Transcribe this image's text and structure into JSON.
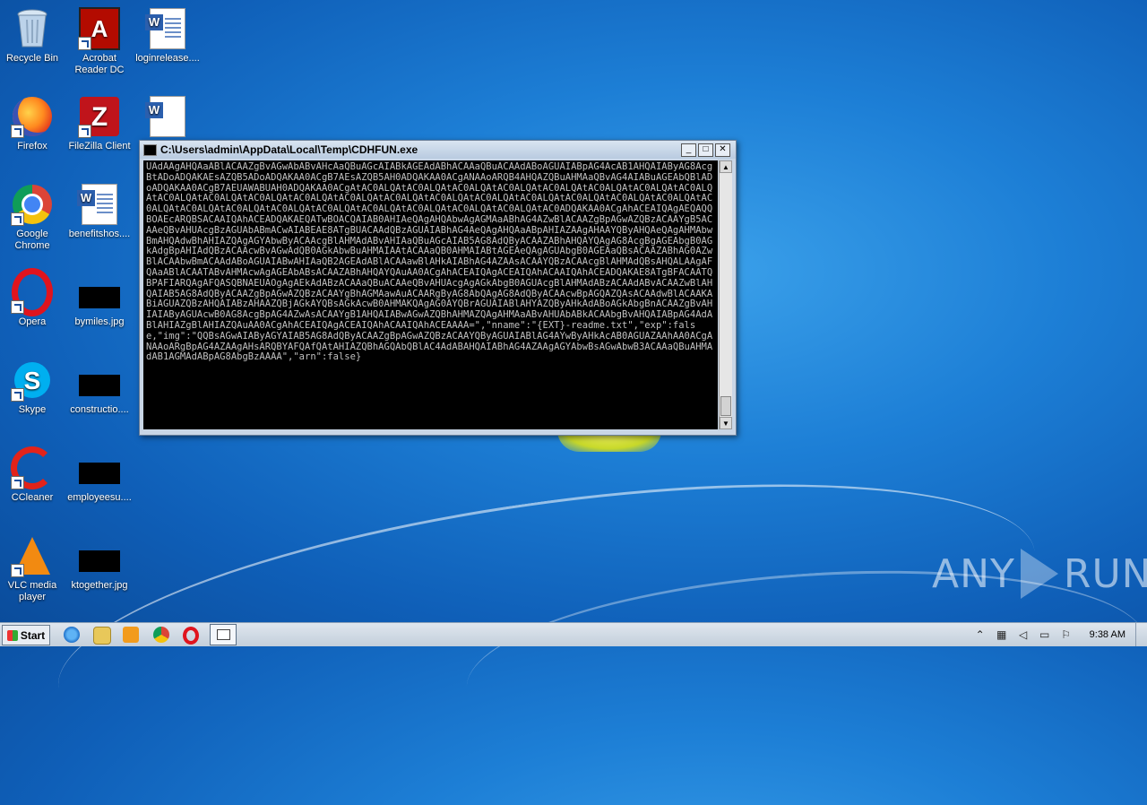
{
  "desktop": {
    "icons": [
      {
        "label": "Recycle Bin",
        "icon": "recycle-bin-icon"
      },
      {
        "label": "Acrobat Reader DC",
        "icon": "acrobat-icon"
      },
      {
        "label": "loginrelease....",
        "icon": "word-doc-icon"
      },
      {
        "label": "Firefox",
        "icon": "firefox-icon"
      },
      {
        "label": "FileZilla Client",
        "icon": "filezilla-icon"
      },
      {
        "label": "",
        "icon": "word-doc-icon"
      },
      {
        "label": "Google Chrome",
        "icon": "chrome-icon"
      },
      {
        "label": "benefitshos....",
        "icon": "word-doc-icon"
      },
      {
        "label": "Opera",
        "icon": "opera-icon"
      },
      {
        "label": "bymiles.jpg",
        "icon": "image-thumb-icon"
      },
      {
        "label": "Skype",
        "icon": "skype-icon"
      },
      {
        "label": "constructio....",
        "icon": "image-thumb-icon"
      },
      {
        "label": "CCleaner",
        "icon": "ccleaner-icon"
      },
      {
        "label": "employeesu....",
        "icon": "image-thumb-icon"
      },
      {
        "label": "VLC media player",
        "icon": "vlc-icon"
      },
      {
        "label": "ktogether.jpg",
        "icon": "image-thumb-icon"
      }
    ]
  },
  "console": {
    "title": "C:\\Users\\admin\\AppData\\Local\\Temp\\CDHFUN.exe",
    "minimize": "_",
    "maximize": "□",
    "close": "✕",
    "output": "UAdAAgAHQAaABlACAAZgBvAGwAbABvAHcAaQBuAGcAIABkAGEAdABhACAAaQBuACAAdABoAGUAIABpAG4AcAB1AHQAIAByAG8AcgBtADoADQAKAEsAZQB5ADoADQAKAA0ACgB7AEsAZQB5AH0ADQAKAA0ACgANAAoARQB4AHQAZQBuAHMAaQBvAG4AIABuAGEAbQBlADoADQAKAA0ACgB7AEUAWABUAH0ADQAKAA0ACgAtAC0ALQAtAC0ALQAtAC0ALQAtAC0ALQAtAC0ALQAtAC0ALQAtAC0ALQAtAC0ALQAtAC0ALQAtAC0ALQAtAC0ALQAtAC0ALQAtAC0ALQAtAC0ALQAtAC0ALQAtAC0ALQAtAC0ALQAtAC0ALQAtAC0ALQAtAC0ALQAtAC0ALQAtAC0ALQAtAC0ALQAtAC0ALQAtAC0ALQAtAC0ALQAtAC0ALQAtAC0ALQAtAC0ALQAtAC0ADQAKAA0ACgAhACEAIQAgAEQAQQBOAEcARQBSACAAIQAhACEADQAKAEQATwBOACQAIAB0AHIAeQAgAHQAbwAgAGMAaABhAG4AZwBlACAAZgBpAGwAZQBzACAAYgB5ACAAeQBvAHUAcgBzAGUAbABmACwAIABEAE8ATgBUACAAdQBzAGUAIABhAG4AeQAgAHQAaABpAHIAZAAgAHAAYQByAHQAeQAgAHMAbwBmAHQAdwBhAHIAZQAgAGYAbwByACAAcgBlAHMAdABvAHIAaQBuAGcAIAB5AG8AdQByACAAZABhAHQAYQAgAG8AcgBgAGEAbgB0AGkAdgBpAHIAdQBzACAAcwBvAGwAdQB0AGkAbwBuAHMAIAAtACAAaQB0AHMAIABtAGEAeQAgAGUAbgB0AGEAaQBsACAAZABhAG0AZwBlACAAbwBmACAAdABoAGUAIABwAHIAaQB2AGEAdABlACAAawBlAHkAIABhAG4AZAAsACAAYQBzACAAcgBlAHMAdQBsAHQALAAgAFQAaABlACAATABvAHMAcwAgAGEAbABsACAAZABhAHQAYQAuAA0ACgAhACEAIQAgACEAIQAhACAAIQAhACEADQAKAE8ATgBFACAATQBPAFIARQAgAFQASQBNAEUAOgAgAEkAdABzACAAaQBuACAAeQBvAHUAcgAgAGkAbgB0AGUAcgBlAHMAdABzACAAdABvACAAZwBlAHQAIAB5AG8AdQByACAAZgBpAGwAZQBzACAAYgBhAGMAawAuACAARgByAG8AbQAgAG8AdQByACAAcwBpAGQAZQAsACAAdwBlACAAKABiAGUAZQBzAHQAIABzAHAAZQBjAGkAYQBsAGkAcwB0AHMAKQAgAG0AYQBrAGUAIABlAHYAZQByAHkAdABoAGkAbgBnACAAZgBvAHIAIAByAGUAcwB0AG8AcgBpAG4AZwAsACAAYgB1AHQAIABwAGwAZQBhAHMAZQAgAHMAaABvAHUAbABkACAAbgBvAHQAIABpAG4AdABlAHIAZgBlAHIAZQAuAA0ACgAhACEAIQAgACEAIQAhACAAIQAhACEAAAA=\",\"nname\":\"{EXT}-readme.txt\",\"exp\":false,\"img\":\"QQBsAGwAIAByAGYAIAB5AG8AdQByACAAZgBpAGwAZQBzACAAYQByAGUAIABlAG4AYwByAHkAcAB0AGUAZAAhAA0ACgANAAoARgBpAG4AZAAgAHsARQBYAFQAfQAtAHIAZQBhAGQAbQBlAC4AdABAHQAIABhAG4AZAAgAGYAbwBsAGwAbwB3ACAAaQBuAHMAdAB1AGMAdABpAG8AbgBzAAAA\",\"arn\":false}"
  },
  "taskbar": {
    "start_label": "Start",
    "clock": "9:38 AM"
  },
  "watermark": {
    "left": "ANY",
    "right": "RUN"
  },
  "colors": {
    "desktop_blue": "#1d7fd6",
    "console_bg": "#000000",
    "console_text": "#c0c0c0"
  }
}
